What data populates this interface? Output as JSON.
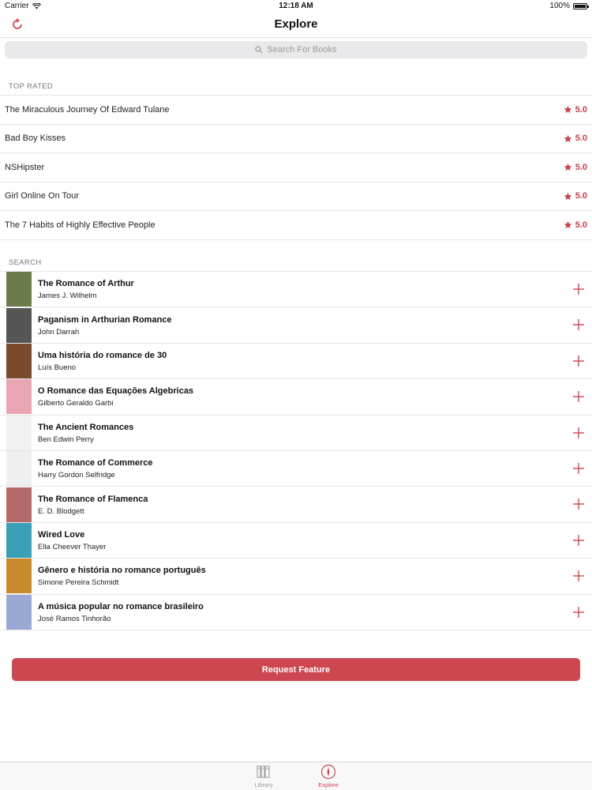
{
  "status_bar": {
    "carrier": "Carrier",
    "time": "12:18 AM",
    "battery": "100%"
  },
  "nav": {
    "title": "Explore",
    "refresh_icon": "refresh-icon"
  },
  "search": {
    "placeholder": "Search For Books",
    "icon": "search-icon"
  },
  "sections": {
    "top_rated": "TOP RATED",
    "search": "SEARCH"
  },
  "top_rated": [
    {
      "title": "The Miraculous Journey Of Edward Tulane",
      "rating": "5.0"
    },
    {
      "title": "Bad Boy Kisses",
      "rating": "5.0"
    },
    {
      "title": "NSHipster",
      "rating": "5.0"
    },
    {
      "title": "Girl Online On Tour",
      "rating": "5.0"
    },
    {
      "title": "The 7 Habits of Highly Effective People",
      "rating": "5.0"
    }
  ],
  "search_results": [
    {
      "title": "The Romance of Arthur",
      "author": "James J. Wilhelm",
      "cover_color": "#6d7b4a"
    },
    {
      "title": "Paganism in Arthurian Romance",
      "author": "John Darrah",
      "cover_color": "#555555"
    },
    {
      "title": "Uma história do romance de 30",
      "author": "Luís Bueno",
      "cover_color": "#7a4a2a"
    },
    {
      "title": "O Romance das Equações Algebricas",
      "author": "Gilberto Geraldo Garbi",
      "cover_color": "#e9a5b4"
    },
    {
      "title": "The Ancient Romances",
      "author": "Ben Edwin Perry",
      "cover_color": "#f1f1f1"
    },
    {
      "title": "The Romance of Commerce",
      "author": "Harry Gordon Selfridge",
      "cover_color": "#efefef"
    },
    {
      "title": "The Romance of Flamenca",
      "author": "E. D. Blodgett",
      "cover_color": "#b46a6a"
    },
    {
      "title": "Wired Love",
      "author": "Ella Cheever Thayer",
      "cover_color": "#3aa0b8"
    },
    {
      "title": "Gênero e história no romance português",
      "author": "Simone Pereira Schmidt",
      "cover_color": "#c98a2e"
    },
    {
      "title": "A música popular no romance brasileiro",
      "author": "José Ramos Tinhorão",
      "cover_color": "#9aa8d6"
    }
  ],
  "request_button": "Request Feature",
  "tabs": [
    {
      "label": "Library",
      "icon": "library-icon"
    },
    {
      "label": "Explore",
      "icon": "compass-icon"
    }
  ],
  "colors": {
    "accent": "#cc474f",
    "star": "#c9404b",
    "separator": "#e6e6e6"
  }
}
